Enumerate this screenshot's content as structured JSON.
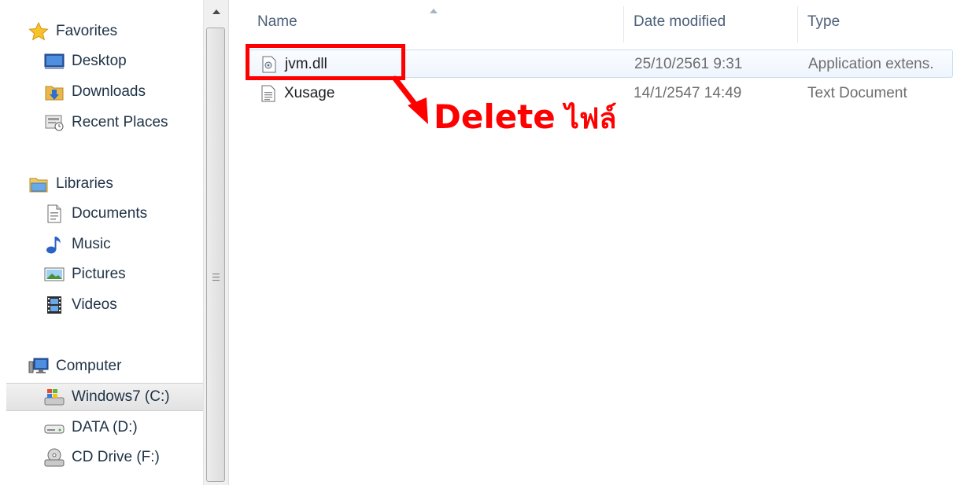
{
  "nav": {
    "favorites": "Favorites",
    "desktop": "Desktop",
    "downloads": "Downloads",
    "recent_places": "Recent Places",
    "libraries": "Libraries",
    "documents": "Documents",
    "music": "Music",
    "pictures": "Pictures",
    "videos": "Videos",
    "computer": "Computer",
    "windows7": "Windows7 (C:)",
    "data": "DATA (D:)",
    "cd_drive": "CD Drive (F:)"
  },
  "columns": {
    "name": "Name",
    "date_modified": "Date modified",
    "type": "Type"
  },
  "files": [
    {
      "name": "jvm.dll",
      "date": "25/10/2561 9:31",
      "type": "Application extens."
    },
    {
      "name": "Xusage",
      "date": "14/1/2547 14:49",
      "type": "Text Document"
    }
  ],
  "annotation": {
    "word": "Delete",
    "thai": "ไฟล์",
    "color": "#ff0000"
  },
  "icons": [
    "star-icon",
    "desktop-icon",
    "downloads-folder-icon",
    "recent-places-icon",
    "libraries-icon",
    "document-icon",
    "music-note-icon",
    "pictures-icon",
    "film-icon",
    "computer-icon",
    "windows-drive-icon",
    "hard-drive-icon",
    "cd-drive-icon",
    "dll-file-icon",
    "text-file-icon",
    "scroll-up-arrow-icon",
    "sort-arrow-icon"
  ]
}
